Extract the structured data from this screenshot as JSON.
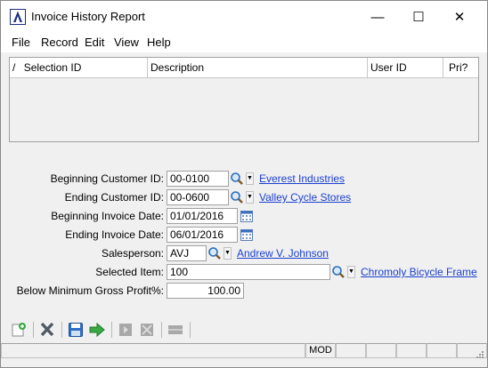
{
  "window": {
    "title": "Invoice History Report",
    "minimize_glyph": "—",
    "maximize_glyph": "☐",
    "close_glyph": "✕"
  },
  "menu": [
    "File",
    "Record",
    "Edit",
    "View",
    "Help"
  ],
  "grid": {
    "columns": [
      {
        "label": "Selection ID",
        "sort_indicator": "/"
      },
      {
        "label": "Description"
      },
      {
        "label": "User ID"
      },
      {
        "label": "Pri?"
      }
    ],
    "rows": []
  },
  "form": {
    "beginning_customer": {
      "label": "Beginning Customer ID:",
      "value": "00-0100",
      "link": "Everest Industries"
    },
    "ending_customer": {
      "label": "Ending Customer ID:",
      "value": "00-0600",
      "link": "Valley Cycle Stores"
    },
    "beginning_invoice_date": {
      "label": "Beginning Invoice Date:",
      "value": "01/01/2016"
    },
    "ending_invoice_date": {
      "label": "Ending Invoice Date:",
      "value": "06/01/2016"
    },
    "salesperson": {
      "label": "Salesperson:",
      "value": "AVJ",
      "link": "Andrew V. Johnson"
    },
    "selected_item": {
      "label": "Selected Item:",
      "value": "100",
      "link": "Chromoly Bicycle Frame"
    },
    "below_min_gp": {
      "label": "Below Minimum Gross Profit%:",
      "value": "100.00"
    }
  },
  "toolbar": [
    "new-record-icon",
    "delete-icon",
    "save-icon",
    "run-report-icon",
    "disabled-icon",
    "disabled-expand-icon",
    "disabled-bar-icon"
  ],
  "status": {
    "mode": "MOD"
  },
  "colors": {
    "link": "#1a3fd0",
    "window_bg": "#f0f0f0",
    "app_icon": "#1b2f7e"
  }
}
